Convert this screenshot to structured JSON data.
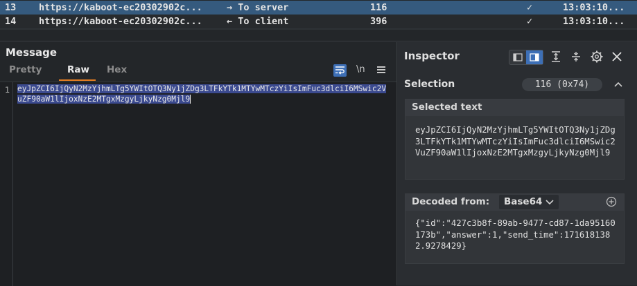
{
  "history": {
    "rows": [
      {
        "id": "13",
        "url": "https://kaboot-ec20302902c...",
        "direction": "→ To server",
        "length": "116",
        "check": "✓",
        "time": "13:03:10..."
      },
      {
        "id": "14",
        "url": "https://kaboot-ec20302902c...",
        "direction": "← To client",
        "length": "396",
        "check": "✓",
        "time": "13:03:10..."
      }
    ],
    "selected_row_color": "#355a7e"
  },
  "message": {
    "title": "Message",
    "tabs": [
      {
        "label": "Pretty",
        "active": false
      },
      {
        "label": "Raw",
        "active": true
      },
      {
        "label": "Hex",
        "active": false
      }
    ],
    "newline_toggle": "\\n",
    "line_number": "1",
    "content": "eyJpZCI6IjQyN2MzYjhmLTg5YWItOTQ3Ny1jZDg3LTFkYTk1MTYwMTczYiIsImFuc3dlciI6MSwic2VuZF90aW1lIjoxNzE2MTgxMzgyLjkyNzg0Mjl9",
    "selection_color": "#3b4a8f",
    "accent_color": "#e67e22"
  },
  "inspector": {
    "title": "Inspector",
    "section_title": "Selection",
    "selection_badge": "116 (0x74)",
    "selected_text_header": "Selected text",
    "selected_text": "eyJpZCI6IjQyN2MzYjhmLTg5YWItOTQ3Ny1jZDg3LTFkYTk1MTYwMTczYiIsImFuc3dlciI6MSwic2VuZF90aW1lIjoxNzE2MTgxMzgyLjkyNzg0Mjl9",
    "decoded_from_label": "Decoded from:",
    "decoder": "Base64",
    "decoded_text": "{\"id\":\"427c3b8f-89ab-9477-cd87-1da95160173b\",\"answer\":1,\"send_time\":1716181382.9278429}",
    "icons": [
      "layout-horizontal-icon",
      "layout-vertical-icon",
      "expand-icon",
      "collapse-icon",
      "gear-icon",
      "close-icon"
    ]
  }
}
